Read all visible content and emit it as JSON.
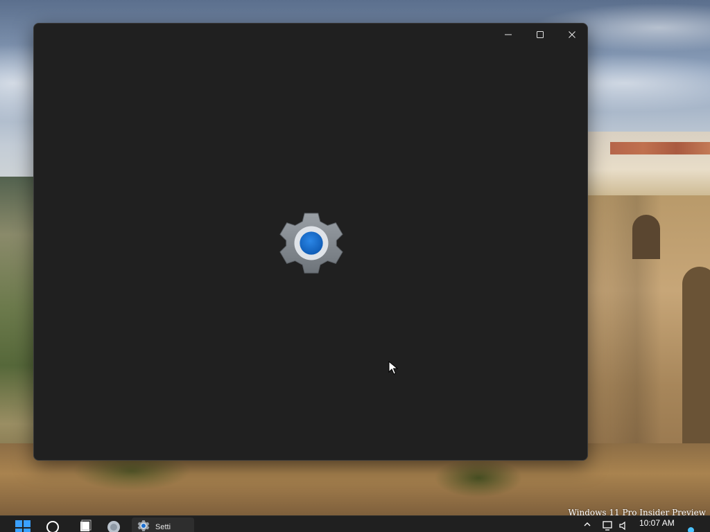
{
  "watermark": "Windows 11 Pro Insider Preview",
  "window": {
    "caption_buttons": [
      {
        "name": "minimize",
        "icon": "minimize-icon"
      },
      {
        "name": "maximize",
        "icon": "maximize-icon"
      },
      {
        "name": "close",
        "icon": "close-icon"
      }
    ],
    "splash_icon": "settings-gear-icon",
    "background_color": "#202020",
    "accent_color": "#1a6fd1"
  },
  "taskbar": {
    "items": [
      {
        "name": "start",
        "icon": "windows-logo-icon"
      },
      {
        "name": "search",
        "icon": "search-icon"
      },
      {
        "name": "task-view",
        "icon": "task-view-icon"
      },
      {
        "name": "edge",
        "icon": "edge-icon"
      },
      {
        "name": "settings",
        "icon": "settings-gear-icon",
        "label": "Setti"
      }
    ],
    "tray": {
      "icons": [
        "chevron-up-icon",
        "network-icon",
        "volume-icon"
      ],
      "time": "10:07 AM"
    },
    "background_color": "#202020"
  }
}
